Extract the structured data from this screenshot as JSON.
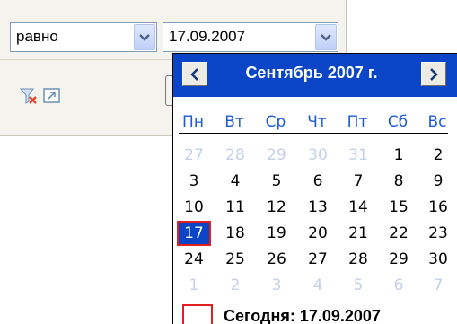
{
  "filter": {
    "operator": {
      "selected": "равно"
    },
    "date_field": {
      "value": "17.09.2007"
    },
    "tools": {
      "clear_filter_icon": "funnel-clear-icon",
      "expand_icon": "expand-arrow-icon"
    }
  },
  "calendar": {
    "title": "Сентябрь 2007 г.",
    "weekdays": [
      "Пн",
      "Вт",
      "Ср",
      "Чт",
      "Пт",
      "Сб",
      "Вс"
    ],
    "weeks": [
      [
        {
          "d": "27",
          "o": true
        },
        {
          "d": "28",
          "o": true
        },
        {
          "d": "29",
          "o": true
        },
        {
          "d": "30",
          "o": true
        },
        {
          "d": "31",
          "o": true
        },
        {
          "d": "1"
        },
        {
          "d": "2"
        }
      ],
      [
        {
          "d": "3"
        },
        {
          "d": "4"
        },
        {
          "d": "5"
        },
        {
          "d": "6"
        },
        {
          "d": "7"
        },
        {
          "d": "8"
        },
        {
          "d": "9"
        }
      ],
      [
        {
          "d": "10"
        },
        {
          "d": "11"
        },
        {
          "d": "12"
        },
        {
          "d": "13"
        },
        {
          "d": "14"
        },
        {
          "d": "15"
        },
        {
          "d": "16"
        }
      ],
      [
        {
          "d": "17",
          "sel": true
        },
        {
          "d": "18"
        },
        {
          "d": "19"
        },
        {
          "d": "20"
        },
        {
          "d": "21"
        },
        {
          "d": "22"
        },
        {
          "d": "23"
        }
      ],
      [
        {
          "d": "24"
        },
        {
          "d": "25"
        },
        {
          "d": "26"
        },
        {
          "d": "27"
        },
        {
          "d": "28"
        },
        {
          "d": "29"
        },
        {
          "d": "30"
        }
      ],
      [
        {
          "d": "1",
          "o": true
        },
        {
          "d": "2",
          "o": true
        },
        {
          "d": "3",
          "o": true
        },
        {
          "d": "4",
          "o": true
        },
        {
          "d": "5",
          "o": true
        },
        {
          "d": "6",
          "o": true
        },
        {
          "d": "7",
          "o": true
        }
      ]
    ],
    "today_label": "Сегодня: 17.09.2007",
    "colors": {
      "header": "#0a45c8",
      "selected": "#0a45c8",
      "today_border": "#e02020",
      "other_month": "#c4cfe8",
      "weekday": "#1d5bd4"
    }
  }
}
